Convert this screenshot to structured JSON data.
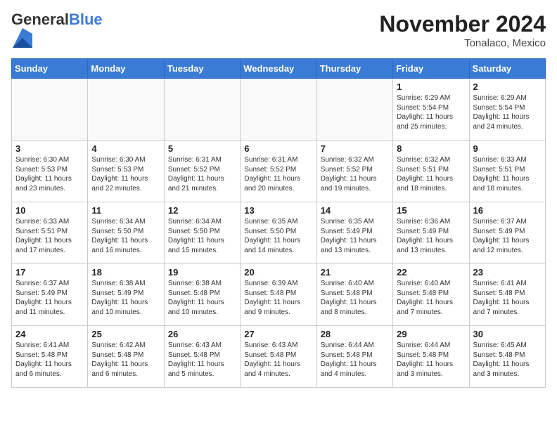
{
  "header": {
    "logo_general": "General",
    "logo_blue": "Blue",
    "month_title": "November 2024",
    "subtitle": "Tonalaco, Mexico"
  },
  "weekdays": [
    "Sunday",
    "Monday",
    "Tuesday",
    "Wednesday",
    "Thursday",
    "Friday",
    "Saturday"
  ],
  "weeks": [
    [
      {
        "day": "",
        "info": ""
      },
      {
        "day": "",
        "info": ""
      },
      {
        "day": "",
        "info": ""
      },
      {
        "day": "",
        "info": ""
      },
      {
        "day": "",
        "info": ""
      },
      {
        "day": "1",
        "info": "Sunrise: 6:29 AM\nSunset: 5:54 PM\nDaylight: 11 hours\nand 25 minutes."
      },
      {
        "day": "2",
        "info": "Sunrise: 6:29 AM\nSunset: 5:54 PM\nDaylight: 11 hours\nand 24 minutes."
      }
    ],
    [
      {
        "day": "3",
        "info": "Sunrise: 6:30 AM\nSunset: 5:53 PM\nDaylight: 11 hours\nand 23 minutes."
      },
      {
        "day": "4",
        "info": "Sunrise: 6:30 AM\nSunset: 5:53 PM\nDaylight: 11 hours\nand 22 minutes."
      },
      {
        "day": "5",
        "info": "Sunrise: 6:31 AM\nSunset: 5:52 PM\nDaylight: 11 hours\nand 21 minutes."
      },
      {
        "day": "6",
        "info": "Sunrise: 6:31 AM\nSunset: 5:52 PM\nDaylight: 11 hours\nand 20 minutes."
      },
      {
        "day": "7",
        "info": "Sunrise: 6:32 AM\nSunset: 5:52 PM\nDaylight: 11 hours\nand 19 minutes."
      },
      {
        "day": "8",
        "info": "Sunrise: 6:32 AM\nSunset: 5:51 PM\nDaylight: 11 hours\nand 18 minutes."
      },
      {
        "day": "9",
        "info": "Sunrise: 6:33 AM\nSunset: 5:51 PM\nDaylight: 11 hours\nand 18 minutes."
      }
    ],
    [
      {
        "day": "10",
        "info": "Sunrise: 6:33 AM\nSunset: 5:51 PM\nDaylight: 11 hours\nand 17 minutes."
      },
      {
        "day": "11",
        "info": "Sunrise: 6:34 AM\nSunset: 5:50 PM\nDaylight: 11 hours\nand 16 minutes."
      },
      {
        "day": "12",
        "info": "Sunrise: 6:34 AM\nSunset: 5:50 PM\nDaylight: 11 hours\nand 15 minutes."
      },
      {
        "day": "13",
        "info": "Sunrise: 6:35 AM\nSunset: 5:50 PM\nDaylight: 11 hours\nand 14 minutes."
      },
      {
        "day": "14",
        "info": "Sunrise: 6:35 AM\nSunset: 5:49 PM\nDaylight: 11 hours\nand 13 minutes."
      },
      {
        "day": "15",
        "info": "Sunrise: 6:36 AM\nSunset: 5:49 PM\nDaylight: 11 hours\nand 13 minutes."
      },
      {
        "day": "16",
        "info": "Sunrise: 6:37 AM\nSunset: 5:49 PM\nDaylight: 11 hours\nand 12 minutes."
      }
    ],
    [
      {
        "day": "17",
        "info": "Sunrise: 6:37 AM\nSunset: 5:49 PM\nDaylight: 11 hours\nand 11 minutes."
      },
      {
        "day": "18",
        "info": "Sunrise: 6:38 AM\nSunset: 5:49 PM\nDaylight: 11 hours\nand 10 minutes."
      },
      {
        "day": "19",
        "info": "Sunrise: 6:38 AM\nSunset: 5:48 PM\nDaylight: 11 hours\nand 10 minutes."
      },
      {
        "day": "20",
        "info": "Sunrise: 6:39 AM\nSunset: 5:48 PM\nDaylight: 11 hours\nand 9 minutes."
      },
      {
        "day": "21",
        "info": "Sunrise: 6:40 AM\nSunset: 5:48 PM\nDaylight: 11 hours\nand 8 minutes."
      },
      {
        "day": "22",
        "info": "Sunrise: 6:40 AM\nSunset: 5:48 PM\nDaylight: 11 hours\nand 7 minutes."
      },
      {
        "day": "23",
        "info": "Sunrise: 6:41 AM\nSunset: 5:48 PM\nDaylight: 11 hours\nand 7 minutes."
      }
    ],
    [
      {
        "day": "24",
        "info": "Sunrise: 6:41 AM\nSunset: 5:48 PM\nDaylight: 11 hours\nand 6 minutes."
      },
      {
        "day": "25",
        "info": "Sunrise: 6:42 AM\nSunset: 5:48 PM\nDaylight: 11 hours\nand 6 minutes."
      },
      {
        "day": "26",
        "info": "Sunrise: 6:43 AM\nSunset: 5:48 PM\nDaylight: 11 hours\nand 5 minutes."
      },
      {
        "day": "27",
        "info": "Sunrise: 6:43 AM\nSunset: 5:48 PM\nDaylight: 11 hours\nand 4 minutes."
      },
      {
        "day": "28",
        "info": "Sunrise: 6:44 AM\nSunset: 5:48 PM\nDaylight: 11 hours\nand 4 minutes."
      },
      {
        "day": "29",
        "info": "Sunrise: 6:44 AM\nSunset: 5:48 PM\nDaylight: 11 hours\nand 3 minutes."
      },
      {
        "day": "30",
        "info": "Sunrise: 6:45 AM\nSunset: 5:48 PM\nDaylight: 11 hours\nand 3 minutes."
      }
    ]
  ]
}
